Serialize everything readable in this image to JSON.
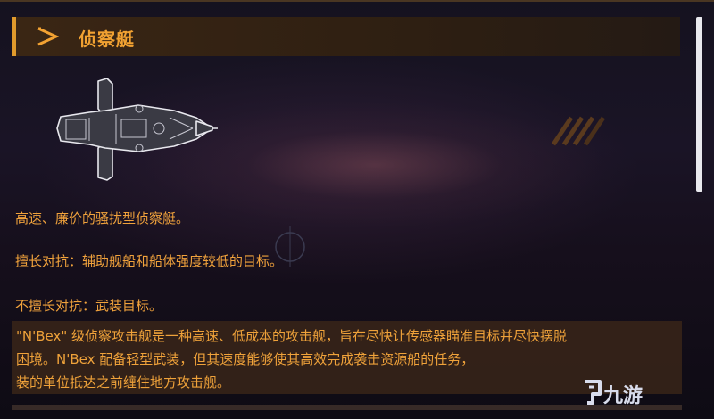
{
  "header": {
    "title": "侦察艇",
    "icon": "play-triangle-icon",
    "accent": "#e09a2c"
  },
  "ship": {
    "icon": "scout-ship-icon"
  },
  "summary": "高速、廉价的骚扰型侦察艇。",
  "strength": "擅长对抗：辅助舰船和船体强度较低的目标。",
  "weakness": "不擅长对抗：武装目标。",
  "description": {
    "lines": [
      "\"N'Bex\" 级侦察攻击舰是一种高速、低成本的攻击舰，旨在尽快让传感器瞄准目标并尽快摆脱",
      "困境。N'Bex 配备轻型武装，但其速度能够使其高效完成袭击资源船的任务，",
      "装的单位抵达之前缠住地方攻击舰。"
    ]
  },
  "watermark": {
    "text": "九游",
    "logo_text": "9"
  },
  "colors": {
    "text": "#f0a23c",
    "background": "#15121f",
    "panel": "#3a2614"
  }
}
